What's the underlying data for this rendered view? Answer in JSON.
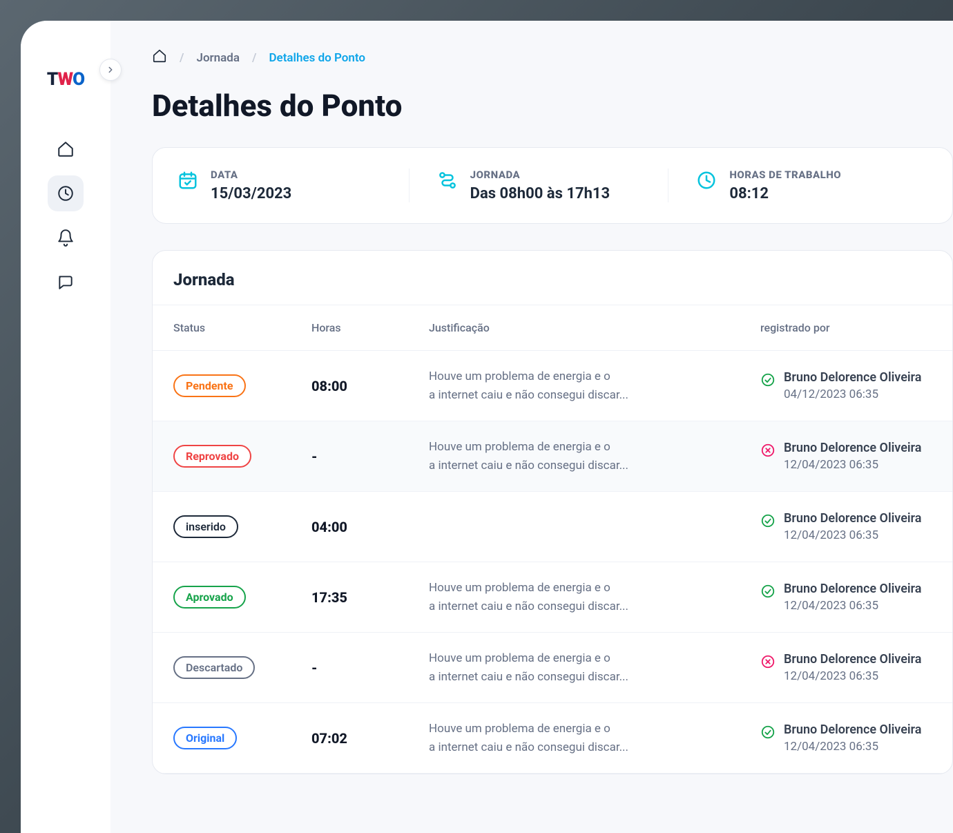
{
  "breadcrumb": {
    "item1": "Jornada",
    "item2": "Detalhes do Ponto"
  },
  "page_title": "Detalhes do Ponto",
  "summary": {
    "date": {
      "label": "DATA",
      "value": "15/03/2023"
    },
    "shift": {
      "label": "JORNADA",
      "value": "Das 08h00 às 17h13"
    },
    "worked": {
      "label": "HORAS DE TRABALHO",
      "value": "08:12"
    }
  },
  "journey": {
    "title": "Jornada",
    "columns": {
      "status": "Status",
      "hours": "Horas",
      "just": "Justificação",
      "reg": "registrado por"
    },
    "rows": [
      {
        "status_label": "Pendente",
        "status_class": "pendente",
        "hours": "08:00",
        "just_l1": "Houve um problema de energia e o",
        "just_l2": "a internet caiu e não consegui discar...",
        "reg_ok": true,
        "reg_name": "Bruno Delorence Oliveira",
        "reg_time": "04/12/2023 06:35"
      },
      {
        "status_label": "Reprovado",
        "status_class": "reprovado",
        "hours": "-",
        "just_l1": "Houve um problema de energia e o",
        "just_l2": "a internet caiu e não consegui discar...",
        "reg_ok": false,
        "reg_name": "Bruno Delorence Oliveira",
        "reg_time": "12/04/2023 06:35"
      },
      {
        "status_label": "inserido",
        "status_class": "inserido",
        "hours": "04:00",
        "just_l1": "",
        "just_l2": "",
        "reg_ok": true,
        "reg_name": "Bruno Delorence Oliveira",
        "reg_time": "12/04/2023 06:35"
      },
      {
        "status_label": "Aprovado",
        "status_class": "aprovado",
        "hours": "17:35",
        "just_l1": "Houve um problema de energia e o",
        "just_l2": "a internet caiu e não consegui discar...",
        "reg_ok": true,
        "reg_name": "Bruno Delorence Oliveira",
        "reg_time": "12/04/2023 06:35"
      },
      {
        "status_label": "Descartado",
        "status_class": "descartado",
        "hours": "-",
        "just_l1": "Houve um problema de energia e o",
        "just_l2": "a internet caiu e não consegui discar...",
        "reg_ok": false,
        "reg_name": "Bruno Delorence Oliveira",
        "reg_time": "12/04/2023 06:35"
      },
      {
        "status_label": "Original",
        "status_class": "original",
        "hours": "07:02",
        "just_l1": "Houve um problema de energia e o",
        "just_l2": "a internet caiu e não consegui discar...",
        "reg_ok": true,
        "reg_name": "Bruno Delorence Oliveira",
        "reg_time": "12/04/2023 06:35"
      }
    ]
  }
}
